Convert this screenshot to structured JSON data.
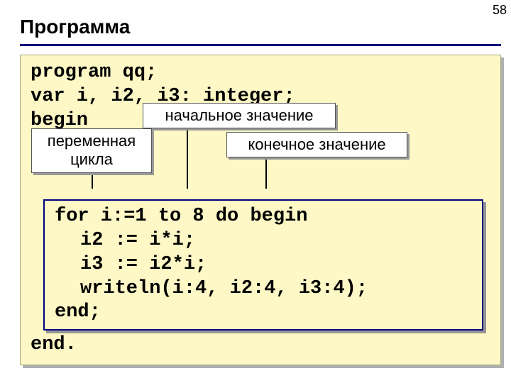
{
  "page_number": "58",
  "title": "Программа",
  "code": {
    "line1": "program qq;",
    "line2": "var i, i2, i3: integer;",
    "line3": "begin"
  },
  "callouts": {
    "loop_variable": "переменная цикла",
    "initial_value": "начальное значение",
    "final_value": "конечное значение"
  },
  "inner_code": {
    "line1": "for i:=1 to 8 do begin",
    "line2": "i2 := i*i;",
    "line3": "i3 := i2*i;",
    "line4": "writeln(i:4, i2:4, i3:4);",
    "line5": "end;"
  },
  "code_end": "end."
}
